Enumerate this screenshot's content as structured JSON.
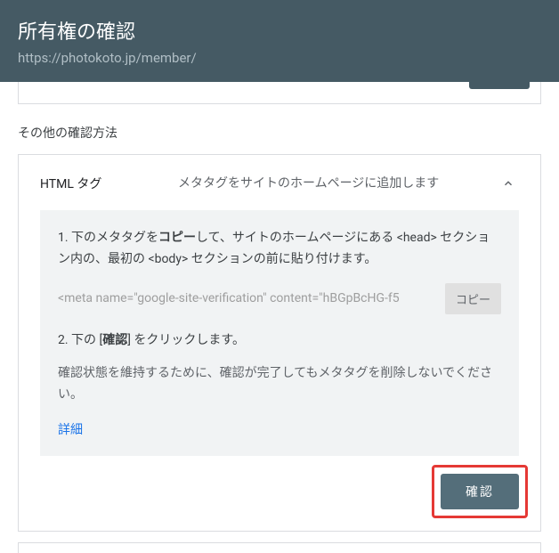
{
  "header": {
    "title": "所有権の確認",
    "url": "https://photokoto.jp/member/"
  },
  "section_label": "その他の確認方法",
  "card": {
    "title": "HTML タグ",
    "description": "メタタグをサイトのホームページに追加します",
    "step1_prefix": "1. 下のメタタグを",
    "step1_bold": "コピー",
    "step1_suffix": "して、サイトのホームページにある <head> セクション内の、最初の <body> セクションの前に貼り付けます。",
    "meta_tag": "<meta name=\"google-site-verification\" content=\"hBGpBcHG-f5",
    "copy_label": "コピー",
    "step2_prefix": "2. 下の [",
    "step2_bold": "確認",
    "step2_suffix": "] をクリックします。",
    "note": "確認状態を維持するために、確認が完了してもメタタグを削除しないでください。",
    "detail_link": "詳細",
    "confirm_label": "確認"
  }
}
